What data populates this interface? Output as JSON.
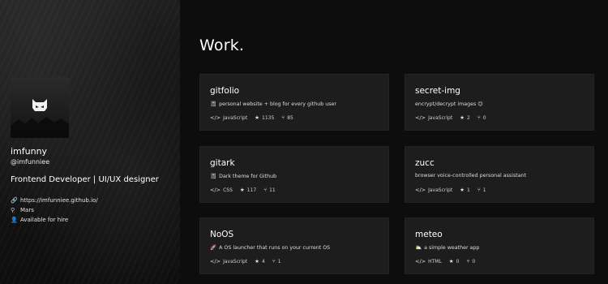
{
  "profile": {
    "name": "imfunny",
    "username": "@imfunniee",
    "bio": "Frontend Developer | UI/UX designer",
    "website": "https://imfunniee.github.io/",
    "location": "Mars",
    "hire": "Available for hire"
  },
  "main": {
    "title": "Work."
  },
  "projects": [
    {
      "name": "gitfolio",
      "emoji": "📓",
      "description": "personal website + blog for every github user",
      "language": "JavaScript",
      "stars": "1135",
      "forks": "85"
    },
    {
      "name": "secret-img",
      "emoji": "",
      "description": "encrypt/decrypt images 😉",
      "language": "JavaScript",
      "stars": "2",
      "forks": "0"
    },
    {
      "name": "gitark",
      "emoji": "📓",
      "description": "Dark theme for Github",
      "language": "CSS",
      "stars": "117",
      "forks": "11"
    },
    {
      "name": "zucc",
      "emoji": "",
      "description": "browser voice-controlled personal assistant",
      "language": "JavaScript",
      "stars": "1",
      "forks": "1"
    },
    {
      "name": "NoOS",
      "emoji": "🚀",
      "description": "A OS launcher that runs on your current OS",
      "language": "JavaScript",
      "stars": "4",
      "forks": "1"
    },
    {
      "name": "meteo",
      "emoji": "⛅",
      "description": "a simple weather app",
      "language": "HTML",
      "stars": "0",
      "forks": "0"
    }
  ],
  "icons": {
    "code": "code-icon",
    "star": "star-icon",
    "fork": "fork-icon",
    "link": "link-icon",
    "location": "location-icon",
    "user": "user-icon"
  }
}
